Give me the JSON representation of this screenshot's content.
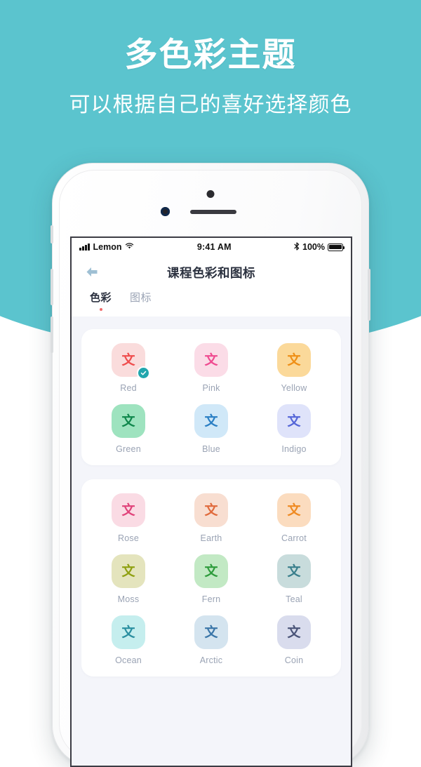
{
  "promo": {
    "title": "多色彩主题",
    "subtitle": "可以根据自己的喜好选择颜色",
    "bg_color": "#5bc4ce"
  },
  "status_bar": {
    "carrier": "Lemon",
    "time": "9:41 AM",
    "battery_pct": "100%",
    "signal_icon": "signal-bars-icon",
    "wifi_icon": "wifi-icon",
    "bluetooth_icon": "bluetooth-icon",
    "battery_icon": "battery-full-icon"
  },
  "nav": {
    "title": "课程色彩和图标",
    "back_icon": "arrow-left-icon",
    "back_icon_color": "#9fc0d4"
  },
  "tabs": [
    {
      "label": "色彩",
      "active": true,
      "dot_color": "#f06a6a"
    },
    {
      "label": "图标",
      "active": false,
      "dot_color": ""
    }
  ],
  "cards": [
    {
      "rows": [
        [
          {
            "name": "Red",
            "bg": "#fadcdc",
            "glyph": "文",
            "glyph_color": "#ef4d4d",
            "selected": true
          },
          {
            "name": "Pink",
            "bg": "#fbdce7",
            "glyph": "文",
            "glyph_color": "#ef4b90",
            "selected": false
          },
          {
            "name": "Yellow",
            "bg": "#fbd99a",
            "glyph": "文",
            "glyph_color": "#ef8f16",
            "selected": false
          }
        ],
        [
          {
            "name": "Green",
            "bg": "#9ee3bf",
            "glyph": "文",
            "glyph_color": "#10874c",
            "selected": false
          },
          {
            "name": "Blue",
            "bg": "#d0e8f8",
            "glyph": "文",
            "glyph_color": "#2b7fc4",
            "selected": false
          },
          {
            "name": "Indigo",
            "bg": "#dfe3fa",
            "glyph": "文",
            "glyph_color": "#5566d8",
            "selected": false
          }
        ]
      ]
    },
    {
      "rows": [
        [
          {
            "name": "Rose",
            "bg": "#fadbe4",
            "glyph": "文",
            "glyph_color": "#e0437a",
            "selected": false
          },
          {
            "name": "Earth",
            "bg": "#f8ded1",
            "glyph": "文",
            "glyph_color": "#e06a3c",
            "selected": false
          },
          {
            "name": "Carrot",
            "bg": "#fbdcbf",
            "glyph": "文",
            "glyph_color": "#ef8a22",
            "selected": false
          }
        ],
        [
          {
            "name": "Moss",
            "bg": "#e4e4bd",
            "glyph": "文",
            "glyph_color": "#8fa012",
            "selected": false
          },
          {
            "name": "Fern",
            "bg": "#c2e9c4",
            "glyph": "文",
            "glyph_color": "#2e9c3c",
            "selected": false
          },
          {
            "name": "Teal",
            "bg": "#c8dcdc",
            "glyph": "文",
            "glyph_color": "#3a7f8c",
            "selected": false
          }
        ],
        [
          {
            "name": "Ocean",
            "bg": "#c5eeee",
            "glyph": "文",
            "glyph_color": "#2a8fa0",
            "selected": false
          },
          {
            "name": "Arctic",
            "bg": "#d4e4ef",
            "glyph": "文",
            "glyph_color": "#3b76a8",
            "selected": false
          },
          {
            "name": "Coin",
            "bg": "#d9dced",
            "glyph": "文",
            "glyph_color": "#4a5478",
            "selected": false
          }
        ]
      ]
    }
  ],
  "selection": {
    "check_icon": "check-icon",
    "badge_color": "#21a6ad"
  }
}
